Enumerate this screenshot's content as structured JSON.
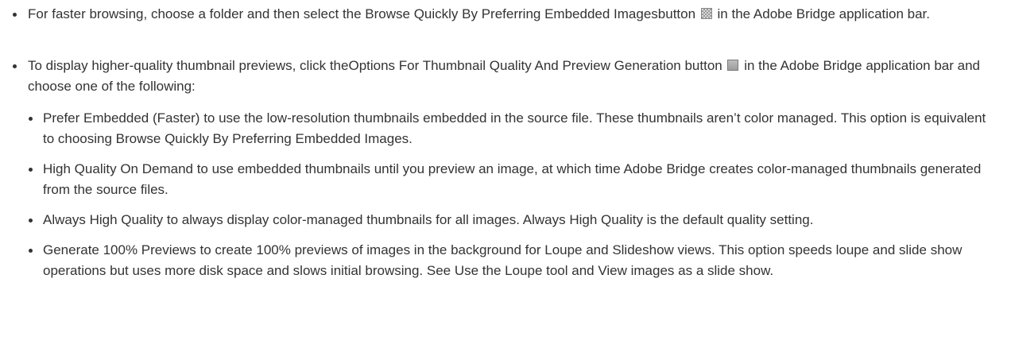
{
  "items": [
    {
      "before": "For faster browsing, choose a folder and then select the Browse Quickly By Preferring Embedded Imagesbutton",
      "icon": "embedded-images-icon",
      "after": "in the Adobe Bridge application bar."
    },
    {
      "before": "To display higher-quality thumbnail previews, click theOptions For Thumbnail Quality And Preview Generation button",
      "icon": "thumbnail-quality-options-icon",
      "after": "in the Adobe Bridge application bar and choose one of the following:",
      "subitems": [
        "Prefer Embedded (Faster) to use the low-resolution thumbnails embedded in the source file. These thumbnails aren’t color managed. This option is equivalent to choosing Browse Quickly By Preferring Embedded Images.",
        "High Quality On Demand to use embedded thumbnails until you preview an image, at which time Adobe Bridge creates color-managed thumbnails generated from the source files.",
        "Always High Quality to always display color-managed thumbnails for all images. Always High Quality is the default quality setting.",
        "Generate 100% Previews to create 100% previews of images in the background for Loupe and Slideshow views. This option speeds loupe and slide show operations but uses more disk space and slows initial browsing. See Use the Loupe tool and View images as a slide show."
      ]
    }
  ]
}
